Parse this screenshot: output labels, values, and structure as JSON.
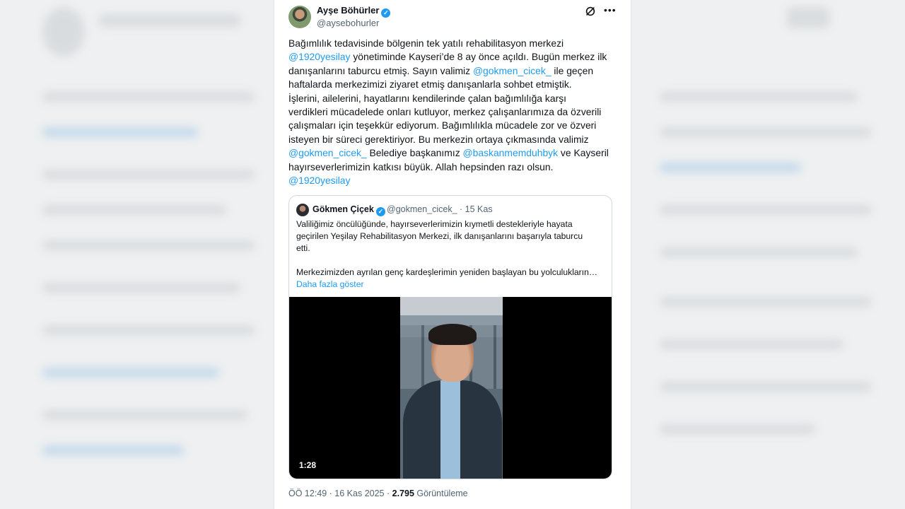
{
  "author": {
    "name": "Ayşe Böhürler",
    "handle": "@aysebohurler"
  },
  "tweet": {
    "lines": [
      [
        {
          "t": "Bağımlılık tedavisinde bölgenin tek yatılı rehabilitasyon merkezi"
        }
      ],
      [
        {
          "t": "@1920yesilay",
          "m": true
        },
        {
          "t": " yönetiminde Kayseri’de 8 ay önce açıldı. Bugün merkez ilk"
        }
      ],
      [
        {
          "t": "danışanlarını taburcu etmiş. Sayın valimiz "
        },
        {
          "t": "@gokmen_cicek_",
          "m": true
        },
        {
          "t": " ile geçen"
        }
      ],
      [
        {
          "t": "haftalarda merkezimizi ziyaret etmiş danışanlarla sohbet etmiştik."
        }
      ],
      [
        {
          "t": "İşlerini, ailelerini, hayatlarını kendilerinde çalan bağımlılığa karşı"
        }
      ],
      [
        {
          "t": "verdikleri mücadelede onları kutluyor, merkez çalışanlarımıza da özverili"
        }
      ],
      [
        {
          "t": "çalışmaları için teşekkür ediyorum. Bağımlılıkla mücadele zor ve  özveri"
        }
      ],
      [
        {
          "t": "isteyen bir süreci gerektiriyor. Bu merkezin ortaya çıkmasında  valimiz"
        }
      ],
      [
        {
          "t": "@gokmen_cicek_",
          "m": true
        },
        {
          "t": "  Belediye başkanımız "
        },
        {
          "t": "@baskanmemduhbyk",
          "m": true
        },
        {
          "t": " ve Kayseril"
        }
      ],
      [
        {
          "t": "hayırseverlerimizin katkısı büyük. Allah hepsinden razı olsun."
        }
      ],
      [
        {
          "t": "@1920yesilay",
          "m": true
        }
      ]
    ]
  },
  "quote": {
    "name": "Gökmen Çiçek",
    "handle_date": "@gokmen_cicek_ · 15 Kas",
    "lines": [
      "Valiliğimiz öncülüğünde, hayırseverlerimizin kıymetli destekleriyle hayata",
      "geçirilen Yeşilay Rehabilitasyon Merkezi, ilk danışanlarını başarıyla taburcu",
      "etti.",
      "",
      "Merkezimizden ayrılan genç kardeşlerimin yeniden başlayan bu yolculukların…"
    ],
    "show_more": "Daha fazla göster",
    "video_duration": "1:28"
  },
  "meta": {
    "time_date": "ÖÖ 12:49 · 16 Kas 2025 · ",
    "views": "2.795",
    "views_label": " Görüntüleme"
  },
  "icons": {
    "verified": "verified-badge-icon",
    "grok": "grok-icon",
    "more": "more-icon"
  },
  "colors": {
    "link": "#1d9bf0",
    "text": "#0f1419",
    "muted": "#536471"
  }
}
